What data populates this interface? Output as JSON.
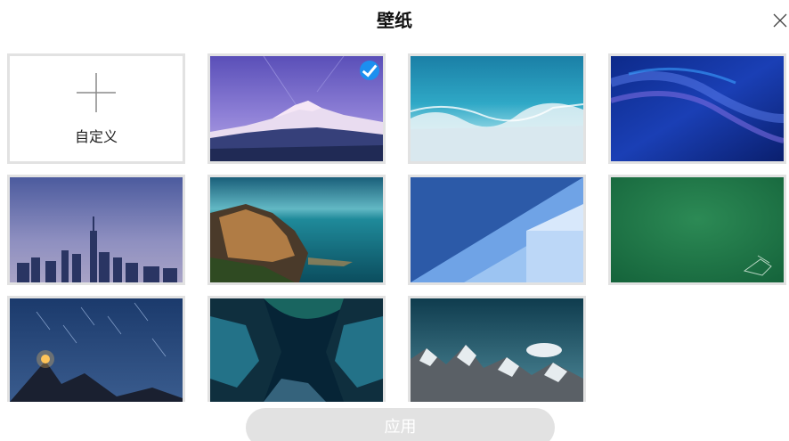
{
  "dialog": {
    "title": "壁纸",
    "close_icon": "close-icon",
    "apply_label": "应用",
    "apply_enabled": false
  },
  "custom_tile": {
    "label": "自定义",
    "icon": "plus-icon"
  },
  "wallpapers": [
    {
      "name": "snowy-mountain-at-dusk",
      "selected": true
    },
    {
      "name": "ocean-waves-aerial",
      "selected": false
    },
    {
      "name": "blue-abstract-waves",
      "selected": false
    },
    {
      "name": "city-skyline-dusk",
      "selected": false
    },
    {
      "name": "coastal-village-night",
      "selected": false
    },
    {
      "name": "blue-geometric-architecture",
      "selected": false
    },
    {
      "name": "green-chalkboard",
      "selected": false
    },
    {
      "name": "star-trails-mountain",
      "selected": false
    },
    {
      "name": "aurora-canyon",
      "selected": false
    },
    {
      "name": "rocky-mountain-peaks",
      "selected": false
    }
  ],
  "colors": {
    "selected_accent": "#1c8ff0",
    "tile_border": "#e2e2e2",
    "apply_disabled_bg": "#e2e2e2"
  }
}
